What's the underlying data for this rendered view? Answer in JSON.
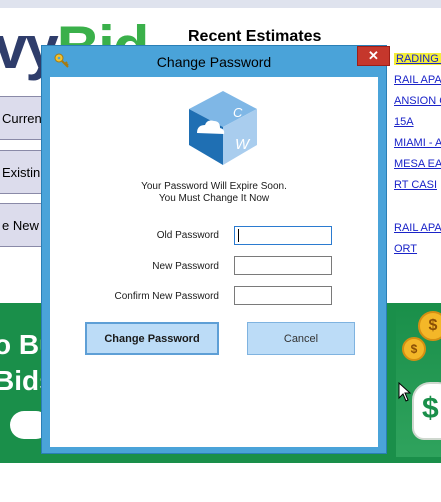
{
  "background": {
    "logo_part1": "vy",
    "logo_part2": "Bid",
    "recent_title": "Recent Estimates",
    "left_buttons": [
      "Curren",
      "Existin",
      "e New I"
    ],
    "right_links": [
      "RADING |",
      "RAIL APA",
      "ANSION C",
      "15A",
      "MIAMI - A",
      "MESA EA",
      "RT  CASI",
      "RAIL APA",
      "ORT"
    ],
    "band_lines": [
      "o Bu",
      "Bids"
    ],
    "band_dots": "• • •",
    "coin_symbol": "$",
    "bag_symbol": "$"
  },
  "dialog": {
    "title": "Change Password",
    "close_label": "✕",
    "logo_letters": [
      "C",
      "W"
    ],
    "message_line1": "Your Password Will Expire Soon.",
    "message_line2": "You Must Change It Now",
    "fields": [
      {
        "label": "Old Password",
        "value": ""
      },
      {
        "label": "New Password",
        "value": ""
      },
      {
        "label": "Confirm New Password",
        "value": ""
      }
    ],
    "change_button": "Change Password",
    "cancel_button": "Cancel"
  },
  "colors": {
    "dialog_frame": "#4aa3d9",
    "close_red": "#c5372c",
    "button_fill": "#bcdcf7",
    "band_green": "#1a8f4a"
  }
}
